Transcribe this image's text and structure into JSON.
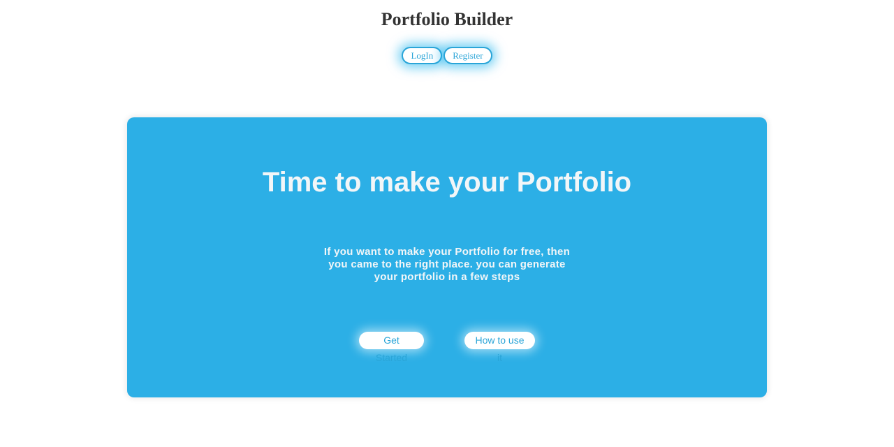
{
  "header": {
    "title": "Portfolio Builder",
    "login_label": "LogIn",
    "register_label": "Register"
  },
  "hero": {
    "title": "Time to make your Portfolio",
    "description": "If you want to make your Portfolio for free, then you came to the right place. you can generate your portfolio in a few steps",
    "get_started_label": "Get Started",
    "how_to_label": "How to use it"
  },
  "colors": {
    "accent": "#2aa5d8",
    "hero_background": "#2cafe6",
    "title_text": "#333333"
  }
}
